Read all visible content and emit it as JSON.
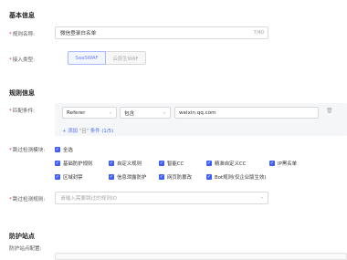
{
  "basic": {
    "section_title": "基本信息",
    "rule_name_label": "规则名称:",
    "rule_name_value": "微信登录白名单",
    "rule_name_counter": "7/40",
    "access_type_label": "接入类型:",
    "access_types": [
      "SaaSWAF",
      "云原生WAF"
    ]
  },
  "rule": {
    "section_title": "规则信息",
    "match_label": "匹配条件:",
    "field": "Referer",
    "operator": "包含",
    "value": "weixin.qq.com",
    "add_prefix": "+ 添加",
    "add_mid": "\"且\"",
    "add_suffix": "条件",
    "add_count": "(1/5)",
    "skip_label": "跳过检测模块:",
    "select_all": "全选",
    "modules": [
      "基础防护规则",
      "自定义规则",
      "智能CC",
      "精准自定义CC",
      "IP黑名单",
      "区域封禁",
      "信息泄露防护",
      "网页防篡改",
      "Bot规则(仅企业版生效)"
    ],
    "skip_rule_label": "跳过检测规则:",
    "skip_rule_placeholder": "请输入需要跳过的规则ID"
  },
  "protect": {
    "section_title": "防护站点",
    "config_label": "防护站点配置:"
  }
}
